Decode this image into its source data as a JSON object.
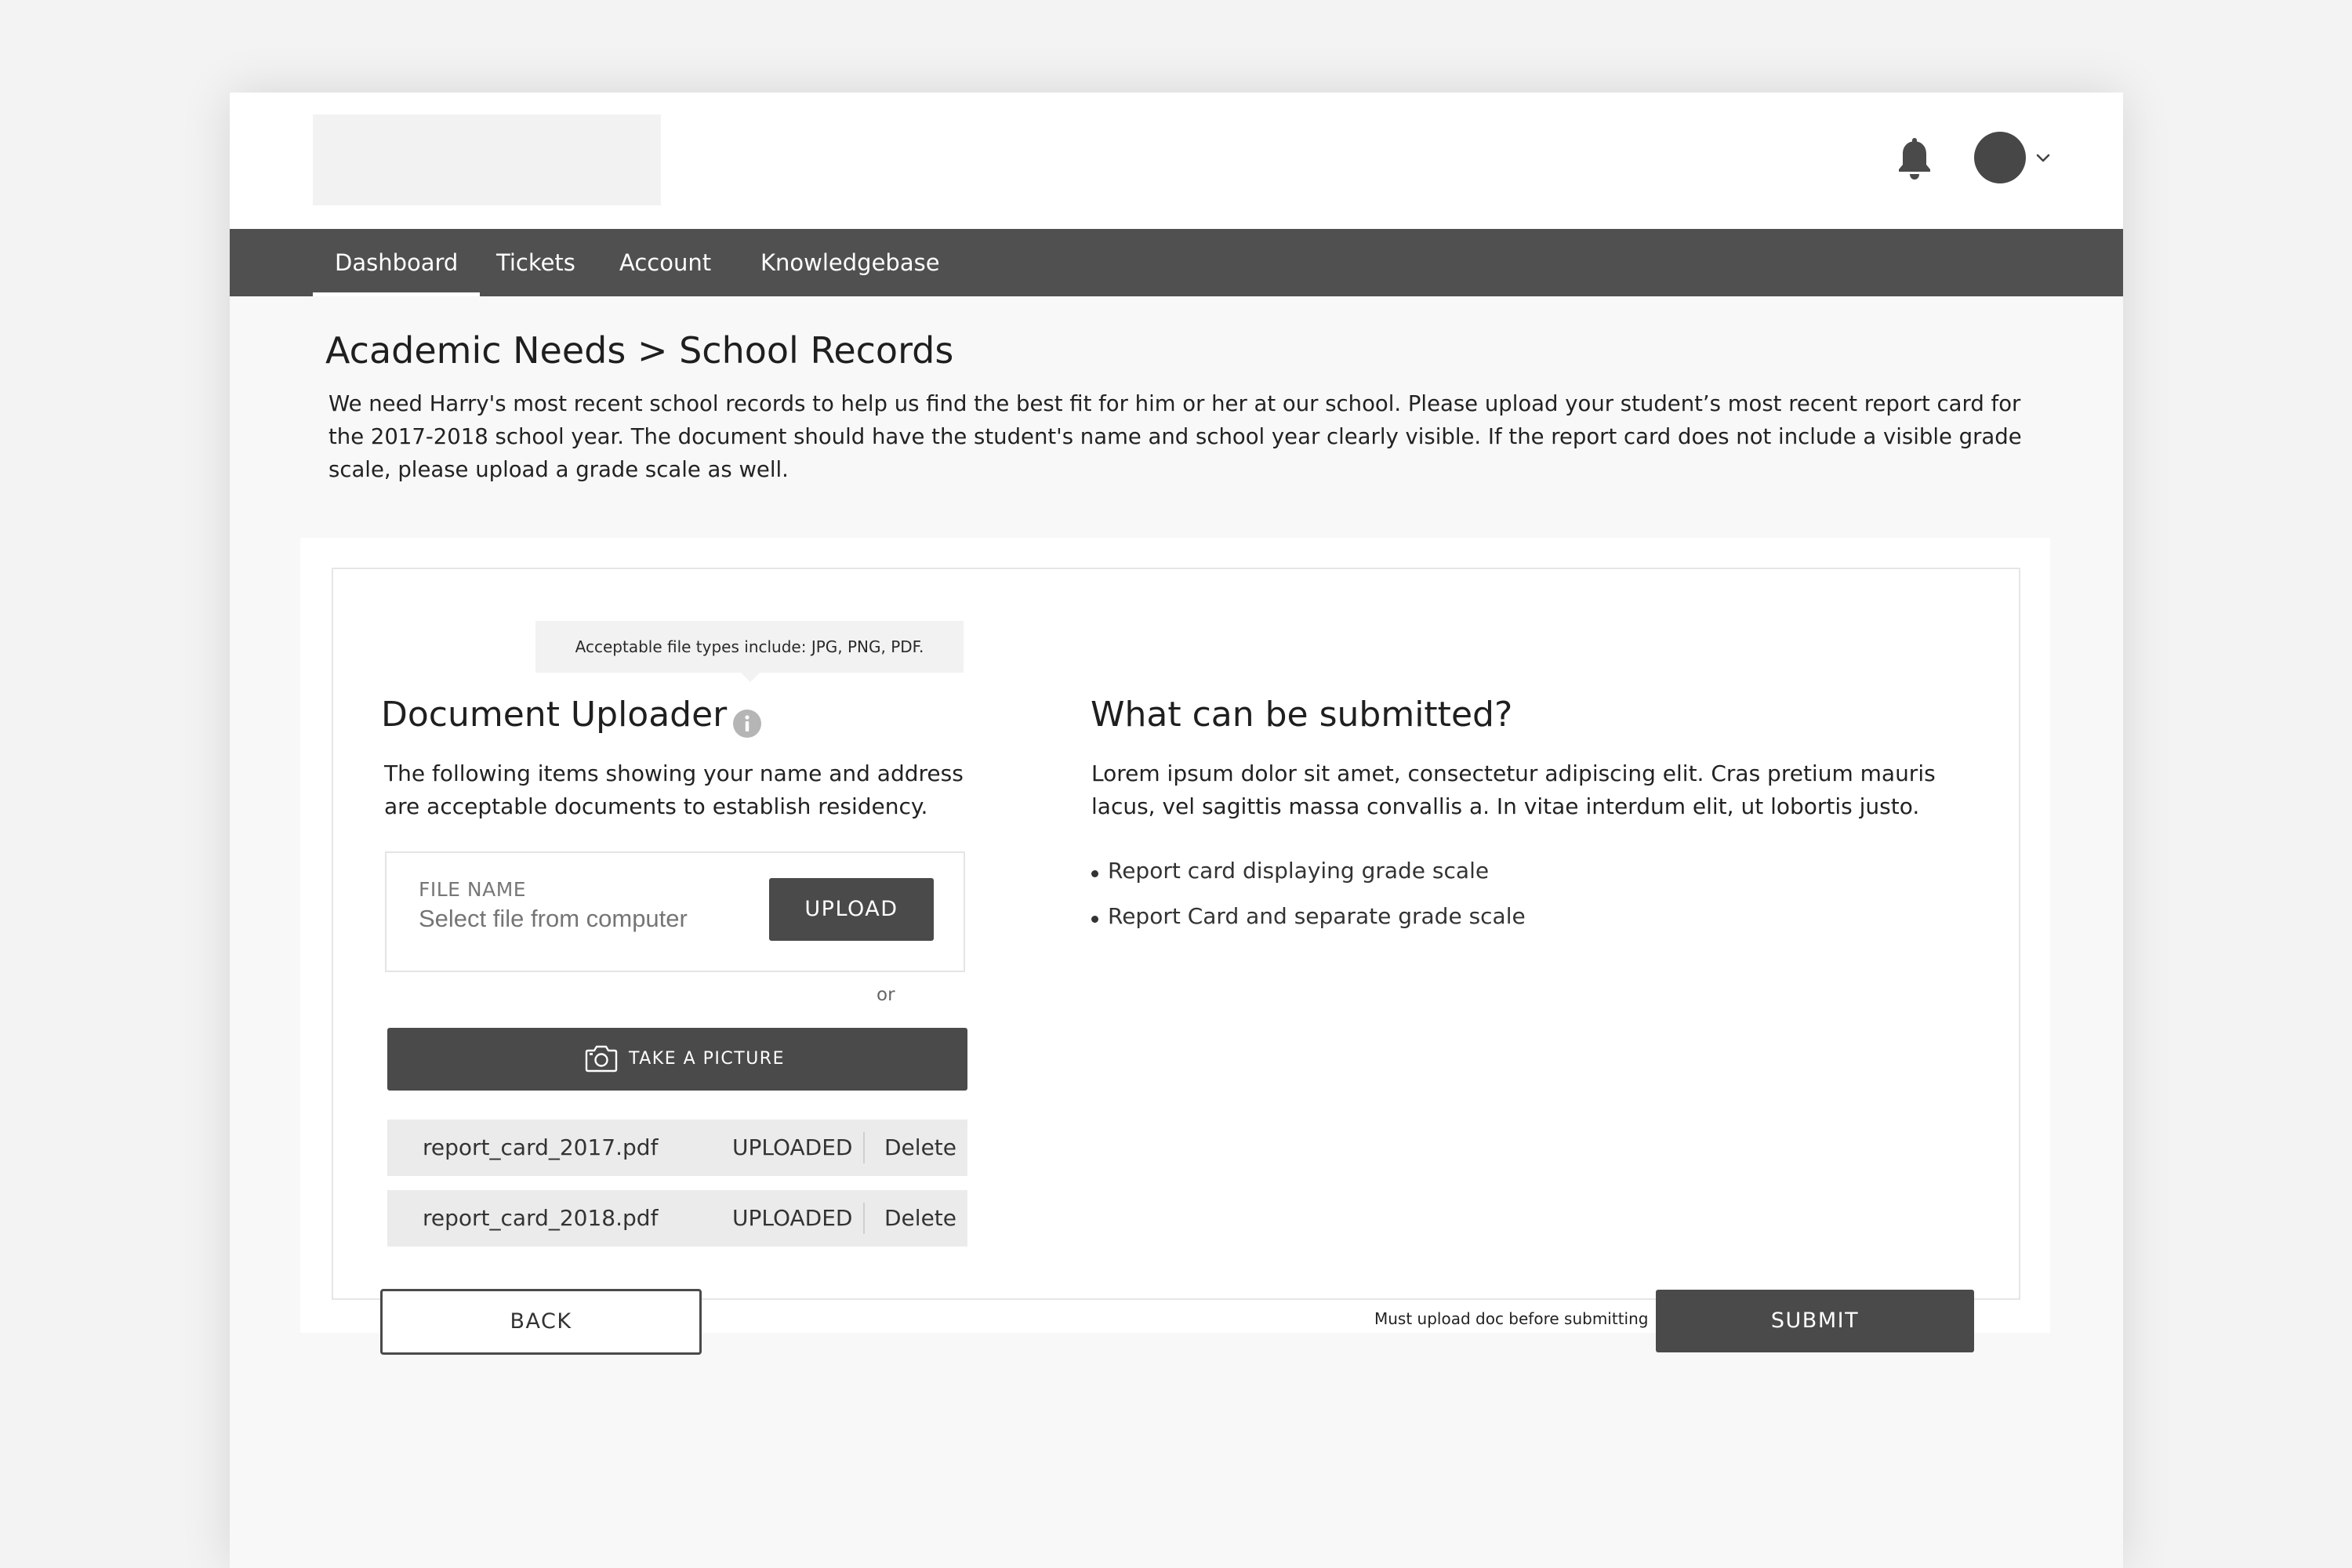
{
  "nav": {
    "items": [
      {
        "label": "Dashboard",
        "active": true
      },
      {
        "label": "Tickets",
        "active": false
      },
      {
        "label": "Account",
        "active": false
      },
      {
        "label": "Knowledgebase",
        "active": false
      }
    ]
  },
  "header": {
    "icons": [
      "bell-icon",
      "avatar",
      "chevron-down-icon"
    ]
  },
  "page": {
    "breadcrumb": "Academic Needs > School Records",
    "intro": "We need Harry's most recent school records to help us find the best fit for him or her at our school. Please upload your student’s most recent report card for the 2017-2018 school year. The document should have the student's name and school year clearly visible. If the report card does not include a visible grade scale, please upload a grade scale as well."
  },
  "uploader": {
    "tooltip": "Acceptable file types include: JPG, PNG, PDF.",
    "title": "Document Uploader",
    "description": "The following items showing your name and address are acceptable documents to establish residency.",
    "file_label": "FILE NAME",
    "file_placeholder": "Select file from computer",
    "upload_button": "UPLOAD",
    "or_text": "or",
    "picture_button": "TAKE A PICTURE",
    "files": [
      {
        "name": "report_card_2017.pdf",
        "status": "UPLOADED",
        "delete": "Delete"
      },
      {
        "name": "report_card_2018.pdf",
        "status": "UPLOADED",
        "delete": "Delete"
      }
    ]
  },
  "submission": {
    "title": "What can be submitted?",
    "description": "Lorem ipsum dolor sit amet, consectetur adipiscing elit. Cras pretium mauris lacus, vel sagittis massa convallis a. In vitae interdum elit, ut lobortis justo.",
    "items": [
      "Report card displaying grade scale",
      "Report Card and separate grade scale"
    ]
  },
  "footer": {
    "back_button": "BACK",
    "must_upload_note": "Must upload doc before submitting",
    "submit_button": "SUBMIT"
  },
  "colors": {
    "nav_bg": "#505050",
    "button_bg": "#4a4a4a",
    "page_bg": "#f8f8f8"
  }
}
